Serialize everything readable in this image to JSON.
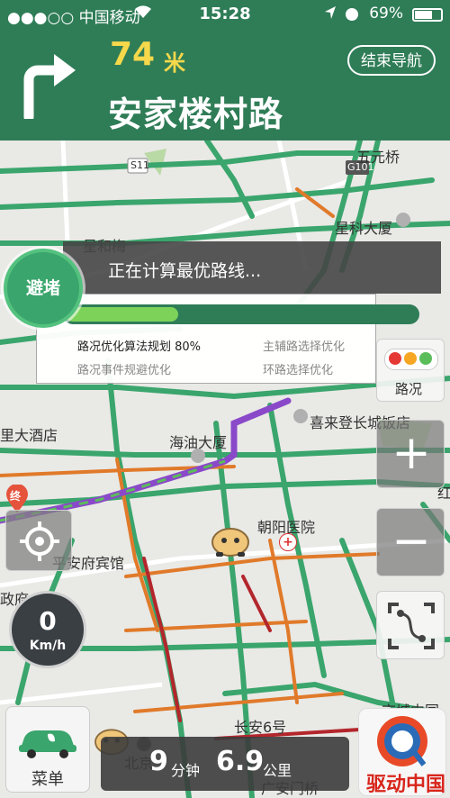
{
  "status_bar": {
    "carrier": "●●●○○ 中国移动",
    "time": "15:28",
    "battery": "69%",
    "battery_level": 0.69
  },
  "navigation": {
    "turn": "right-turn-arrow-icon",
    "distance": "74",
    "distance_unit": "米",
    "street": "安家楼村路",
    "end_button": "结束导航"
  },
  "map": {
    "labels": [
      "五元桥",
      "S11",
      "G101",
      "星科大厦",
      "星和梅",
      "里大酒店",
      "海油大厦",
      "喜来登长城饭店",
      "终",
      "朝阳医院",
      "平安府宾馆",
      "政府",
      "长安6号",
      "北京",
      "京城中国",
      "广安门桥",
      "红"
    ]
  },
  "route_calc": {
    "avoid_button": "避堵",
    "message": "正在计算最优路线...",
    "progress": 0.32,
    "options": [
      "路况优化算法规划 80%",
      "主辅路选择优化",
      "路况事件规避优化",
      "环路选择优化"
    ]
  },
  "controls": {
    "traffic_label": "路况",
    "zoom_in": "+",
    "zoom_out": "−"
  },
  "speed": {
    "value": "0",
    "unit": "Km/h"
  },
  "bottom": {
    "menu_label": "菜单",
    "eta_minutes": "9",
    "eta_minutes_unit": "分钟",
    "distance": "6.9",
    "distance_unit": "公里",
    "watermark": "驱动中国"
  },
  "colors": {
    "header_green": "#2f7d57",
    "route_green": "#3aa56c",
    "traffic_orange": "#e07a2a",
    "traffic_red": "#b3262c",
    "distance_yellow": "#f6d84b"
  }
}
